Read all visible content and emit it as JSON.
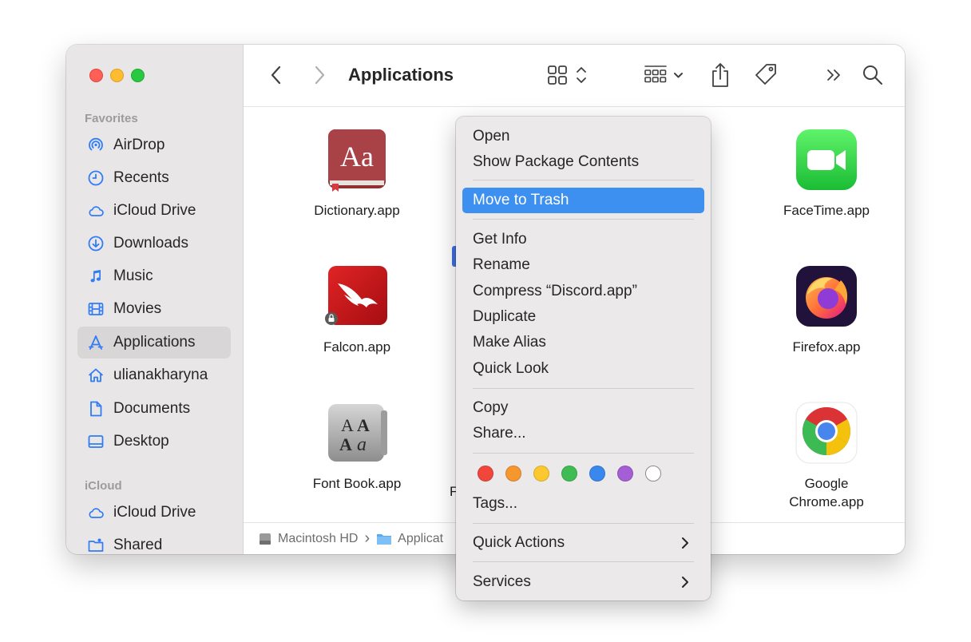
{
  "window": {
    "title": "Applications"
  },
  "sidebar": {
    "favorites_header": "Favorites",
    "icloud_header": "iCloud",
    "items": [
      {
        "label": "AirDrop",
        "icon": "airdrop-icon"
      },
      {
        "label": "Recents",
        "icon": "clock-icon"
      },
      {
        "label": "iCloud Drive",
        "icon": "cloud-icon"
      },
      {
        "label": "Downloads",
        "icon": "download-icon"
      },
      {
        "label": "Music",
        "icon": "music-note-icon"
      },
      {
        "label": "Movies",
        "icon": "film-icon"
      },
      {
        "label": "Applications",
        "icon": "applications-icon",
        "selected": true
      },
      {
        "label": "ulianakharyna",
        "icon": "home-icon"
      },
      {
        "label": "Documents",
        "icon": "document-icon"
      },
      {
        "label": "Desktop",
        "icon": "desktop-icon"
      }
    ],
    "icloud_items": [
      {
        "label": "iCloud Drive",
        "icon": "cloud-icon"
      },
      {
        "label": "Shared",
        "icon": "shared-folder-icon"
      }
    ]
  },
  "files": [
    {
      "name": "Dictionary.app",
      "icon": "dictionary-app-icon"
    },
    {
      "name": "FaceTime.app",
      "icon": "facetime-app-icon"
    },
    {
      "name": "Falcon.app",
      "icon": "falcon-app-icon"
    },
    {
      "name": "Firefox.app",
      "icon": "firefox-app-icon"
    },
    {
      "name": "Font Book.app",
      "icon": "font-book-app-icon"
    },
    {
      "name_line1": "Google",
      "name_line2": "Chrome.app",
      "icon": "chrome-app-icon"
    }
  ],
  "pathbar": {
    "disk": "Macintosh HD",
    "separator": "›",
    "folder": "Applicat"
  },
  "context_menu": {
    "open": "Open",
    "show_package": "Show Package Contents",
    "move_to_trash": "Move to Trash",
    "get_info": "Get Info",
    "rename": "Rename",
    "compress": "Compress “Discord.app”",
    "duplicate": "Duplicate",
    "make_alias": "Make Alias",
    "quick_look": "Quick Look",
    "copy": "Copy",
    "share": "Share...",
    "tags": "Tags...",
    "quick_actions": "Quick Actions",
    "services": "Services",
    "tag_colors": [
      "#f0463c",
      "#f6962e",
      "#fcc830",
      "#3fbd52",
      "#3a87ee",
      "#a45ed6",
      "#ffffff"
    ]
  }
}
